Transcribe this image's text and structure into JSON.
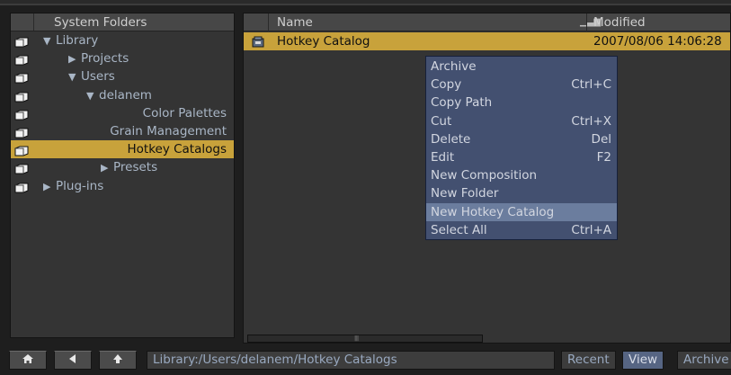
{
  "left_panel": {
    "header": "System Folders",
    "items": [
      {
        "label": "Library",
        "expander": "down",
        "indent": 0,
        "icon": "folder-icon"
      },
      {
        "label": "Projects",
        "expander": "right",
        "indent": 1,
        "icon": "folder-icon"
      },
      {
        "label": "Users",
        "expander": "down",
        "indent": 1,
        "icon": "folder-icon"
      },
      {
        "label": "delanem",
        "expander": "down",
        "indent": 2,
        "icon": "folder-icon"
      },
      {
        "label": "Color Palettes",
        "expander": "none",
        "indent": 3,
        "icon": "folder-icon"
      },
      {
        "label": "Grain Management",
        "expander": "none",
        "indent": 3,
        "icon": "folder-icon"
      },
      {
        "label": "Hotkey Catalogs",
        "expander": "none",
        "indent": 3,
        "icon": "folder-icon",
        "selected": true
      },
      {
        "label": "Presets",
        "expander": "right",
        "indent": 3,
        "icon": "folder-icon"
      },
      {
        "label": "Plug-ins",
        "expander": "right",
        "indent": 0,
        "icon": "folder-icon"
      }
    ]
  },
  "right_panel": {
    "columns": {
      "name": "Name",
      "modified": "Modified",
      "sort_icon": "sort-bars-icon"
    },
    "files": [
      {
        "name": "Hotkey Catalog",
        "modified": "2007/08/06 14:06:28",
        "icon": "hotkey-catalog-icon",
        "selected": true
      }
    ]
  },
  "context_menu": {
    "items": [
      {
        "label": "Archive",
        "shortcut": ""
      },
      {
        "label": "Copy",
        "shortcut": "Ctrl+C"
      },
      {
        "label": "Copy Path",
        "shortcut": ""
      },
      {
        "label": "Cut",
        "shortcut": "Ctrl+X"
      },
      {
        "label": "Delete",
        "shortcut": "Del"
      },
      {
        "label": "Edit",
        "shortcut": "F2"
      },
      {
        "label": "New Composition",
        "shortcut": ""
      },
      {
        "label": "New Folder",
        "shortcut": ""
      },
      {
        "label": "New Hotkey Catalog",
        "shortcut": "",
        "highlighted": true
      },
      {
        "label": "Select All",
        "shortcut": "Ctrl+A"
      }
    ]
  },
  "bottom_bar": {
    "home_icon": "home-icon",
    "back_icon": "back-arrow-icon",
    "up_icon": "up-arrow-icon",
    "path": "Library:/Users/delanem/Hotkey Catalogs",
    "buttons": {
      "recent": "Recent",
      "view": "View",
      "archive": "Archive"
    }
  },
  "colors": {
    "selection": "#c8a23b",
    "menu_bg": "#435070",
    "menu_highlight": "#6b7d9e",
    "panel_bg": "#343434"
  }
}
